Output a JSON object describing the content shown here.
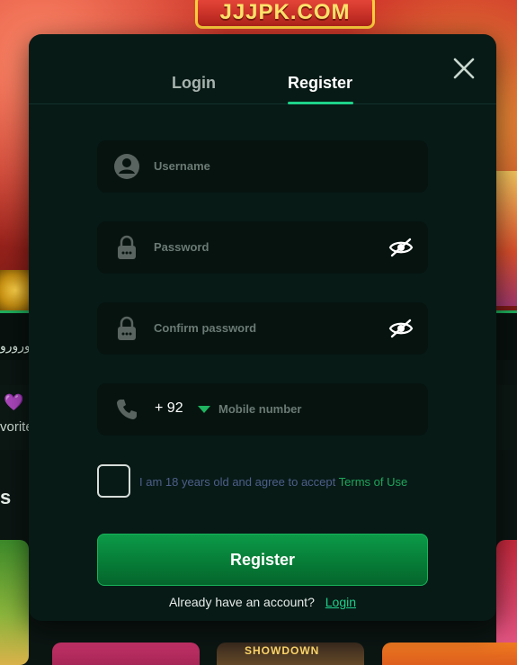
{
  "background": {
    "logo_text": "JJJPK.COM",
    "strip_text": "ورورو",
    "favorites_partial": "vorite",
    "section_partial": "s",
    "tile_text": "SHOWDOWN"
  },
  "modal": {
    "tabs": [
      {
        "label": "Login"
      },
      {
        "label": "Register"
      }
    ],
    "active_tab": "Register",
    "fields": {
      "username_placeholder": "Username",
      "password_placeholder": "Password",
      "confirm_placeholder": "Confirm password",
      "phone_code": "+ 92",
      "phone_placeholder": "Mobile number"
    },
    "agree": {
      "text": "I am 18 years old and agree to accept",
      "link": "Terms of Use",
      "checked": false
    },
    "register_button": "Register",
    "footer": {
      "prompt": "Already have an account?",
      "link": "Login"
    },
    "icons": [
      "close-icon",
      "user-icon",
      "lock-icon",
      "eye-off-icon",
      "phone-icon",
      "caret-down-icon"
    ]
  },
  "colors": {
    "accent": "#1ed18a",
    "button_green": "#067a36",
    "modal_bg": "#071a16",
    "field_bg": "#06130f",
    "link_green": "#1fa55a"
  }
}
